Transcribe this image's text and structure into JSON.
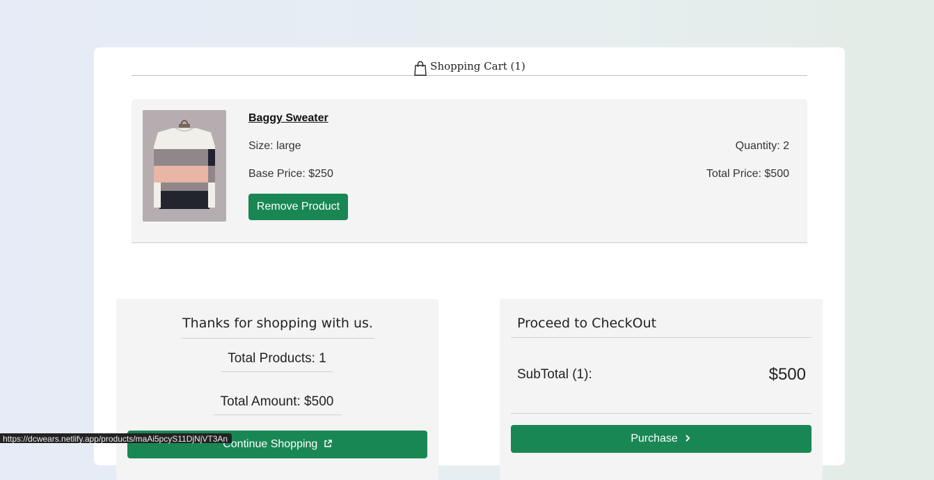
{
  "cart": {
    "title": "Shopping Cart (1)",
    "icon": "shopping-bag-icon"
  },
  "item": {
    "name": "Baggy Sweater",
    "size": "Size: large",
    "base_price": "Base Price: $250",
    "quantity": "Quantity: 2",
    "total_price": "Total Price: $500",
    "remove_label": "Remove Product",
    "image_alt": "Baggy Sweater"
  },
  "summary": {
    "thanks": "Thanks for shopping with us.",
    "total_products": "Total Products: 1",
    "total_amount": "Total Amount: $500",
    "continue_label": "Continue Shopping"
  },
  "checkout": {
    "title": "Proceed to CheckOut",
    "subtotal_label": "SubTotal (1):",
    "subtotal_value": "$500",
    "purchase_label": "Purchase"
  },
  "status_bar": {
    "url": "https://dcwears.netlify.app/products/maAi5pcyS11DjNjVT3An"
  },
  "colors": {
    "primary_button": "#198754",
    "panel_bg": "#f4f4f4"
  }
}
